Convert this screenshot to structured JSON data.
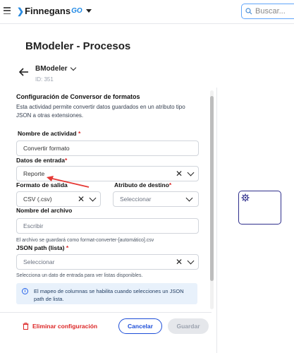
{
  "header": {
    "brand": "Finnegans",
    "brand_suffix": "GO",
    "search_placeholder": "Buscar..."
  },
  "page": {
    "title": "BModeler - Procesos"
  },
  "process": {
    "name": "BModeler",
    "id_label": "ID: 351"
  },
  "config": {
    "title": "Configuración de Conversor de formatos",
    "description": "Esta actividad permite convertir datos guardados en un atributo tipo JSON a otras extensiones.",
    "fields": {
      "activity_name": {
        "label": "Nombre de actividad",
        "required": "*",
        "value": "Convertir formato"
      },
      "input_data": {
        "label": "Datos de entrada",
        "required": "*",
        "value": "Reporte"
      },
      "output_format": {
        "label": "Formato de salida",
        "value": "CSV (.csv)"
      },
      "target_attribute": {
        "label": "Atributo de destino",
        "required": "*",
        "placeholder": "Seleccionar"
      },
      "file_name": {
        "label": "Nombre del archivo",
        "placeholder": "Escribir",
        "hint": "El archivo se guardará como format-converter-[automático].csv"
      },
      "json_path": {
        "label": "JSON path (lista)",
        "required": "*",
        "placeholder": "Seleccionar",
        "hint": "Selecciona un dato de entrada para ver listas disponibles."
      }
    },
    "info_message": "El mapeo de columnas se habilita cuando selecciones un JSON path de lista."
  },
  "footer": {
    "delete_label": "Eliminar configuración",
    "cancel_label": "Cancelar",
    "save_label": "Guardar"
  },
  "colors": {
    "accent": "#1d4ed8",
    "danger": "#dc2626",
    "annotation_arrow": "#e53935"
  },
  "icons": [
    "menu-icon",
    "search-icon",
    "back-arrow-icon",
    "chevron-down-icon",
    "clear-icon",
    "info-icon",
    "trash-icon",
    "gear-icon"
  ]
}
